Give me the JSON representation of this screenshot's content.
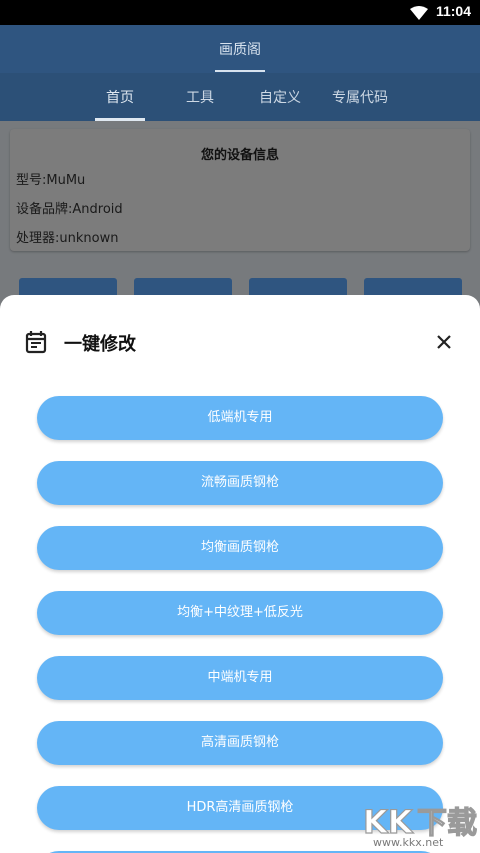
{
  "status_bar": {
    "time": "11:04",
    "wifi_icon": "wifi-icon"
  },
  "app_bar": {
    "title": "画质阁"
  },
  "tabs": [
    {
      "label": "首页",
      "active": true
    },
    {
      "label": "工具",
      "active": false
    },
    {
      "label": "自定义",
      "active": false
    },
    {
      "label": "专属代码",
      "active": false
    }
  ],
  "device_info": {
    "title": "您的设备信息",
    "model": "型号:MuMu",
    "brand": "设备品牌:Android",
    "processor": "处理器:unknown"
  },
  "sheet": {
    "icon": "calendar-icon",
    "title": "一键修改",
    "close_icon": "close-icon",
    "options": [
      "低端机专用",
      "流畅画质钢枪",
      "均衡画质钢枪",
      "均衡+中纹理+低反光",
      "中端机专用",
      "高清画质钢枪",
      "HDR高清画质钢枪"
    ]
  },
  "watermark": {
    "text": "www.kkx.net",
    "logo": "kk下载"
  },
  "colors": {
    "primary": "#2f5580",
    "option_button": "#64b5f6",
    "scrim_content": "#777a7d"
  }
}
